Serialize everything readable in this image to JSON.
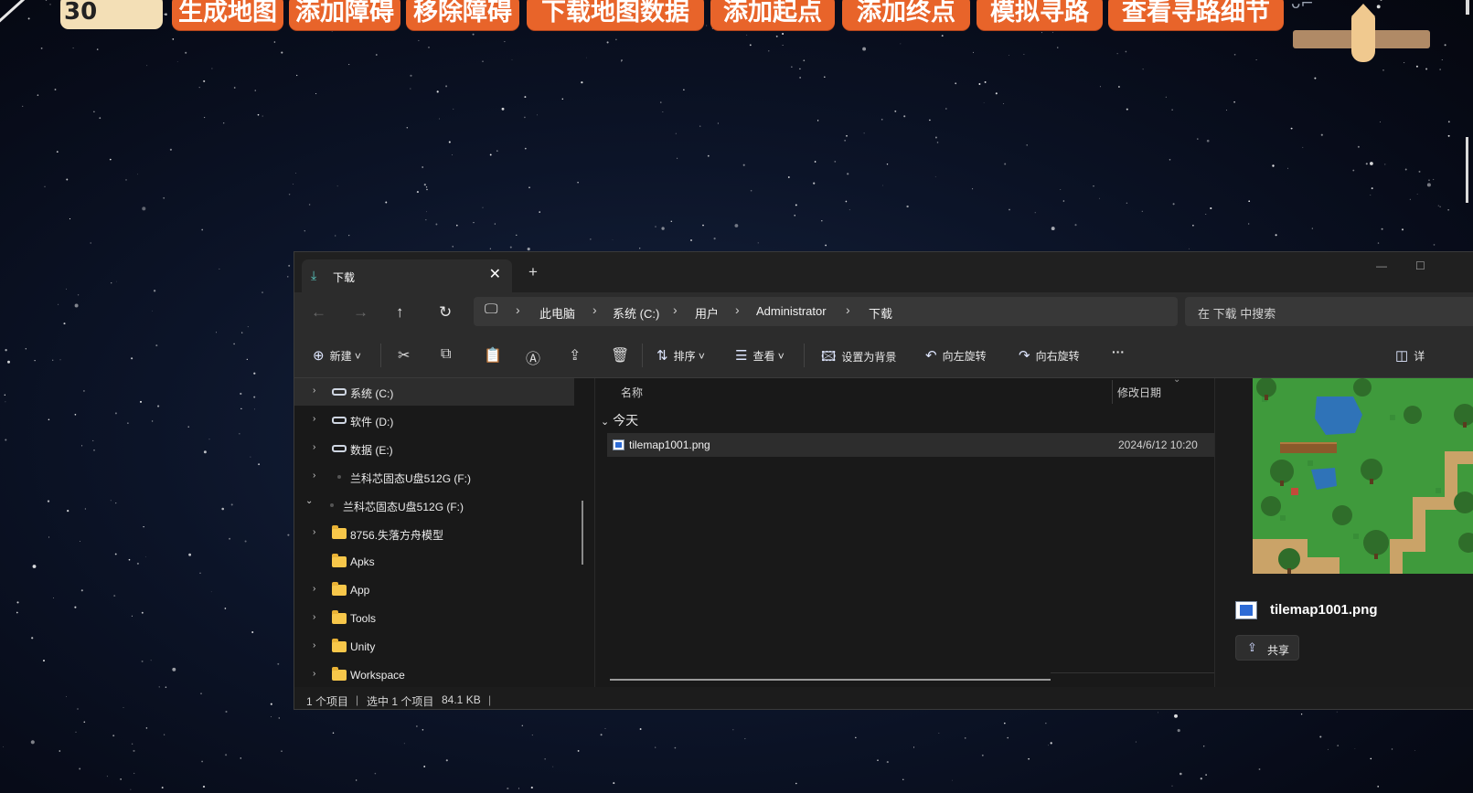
{
  "game": {
    "counter": "30",
    "buttons": [
      "生成地图",
      "添加障碍",
      "移除障碍",
      "下载地图数据",
      "添加起点",
      "添加终点",
      "模拟寻路",
      "查看寻路细节"
    ],
    "button_color": "#e8642a"
  },
  "explorer": {
    "tab": {
      "title": "下载",
      "icon": "download-icon",
      "close": "✕",
      "add": "+"
    },
    "window_controls": {
      "minimize": "—",
      "maximize": "☐"
    },
    "breadcrumb": [
      "此电脑",
      "系统 (C:)",
      "用户",
      "Administrator",
      "下载"
    ],
    "search_placeholder": "在 下载 中搜索",
    "commands": {
      "new": "新建",
      "sort": "排序",
      "view": "查看",
      "set_background": "设置为背景",
      "rotate_left": "向左旋转",
      "rotate_right": "向右旋转",
      "more": "···",
      "details": "详"
    },
    "tree": [
      {
        "label": "系统 (C:)",
        "type": "drive",
        "expandable": true,
        "selected": true
      },
      {
        "label": "软件 (D:)",
        "type": "drive",
        "expandable": true
      },
      {
        "label": "数据 (E:)",
        "type": "drive",
        "expandable": true
      },
      {
        "label": "兰科芯固态U盘512G (F:)",
        "type": "usb",
        "expandable": true
      },
      {
        "label": "兰科芯固态U盘512G (F:)",
        "type": "usb",
        "expanded": true
      },
      {
        "label": "8756.失落方舟模型",
        "type": "folder",
        "expandable": true
      },
      {
        "label": "Apks",
        "type": "folder",
        "expandable": false
      },
      {
        "label": "App",
        "type": "folder",
        "expandable": true
      },
      {
        "label": "Tools",
        "type": "folder",
        "expandable": true
      },
      {
        "label": "Unity",
        "type": "folder",
        "expandable": true
      },
      {
        "label": "Workspace",
        "type": "folder",
        "expandable": true
      }
    ],
    "columns": {
      "name": "名称",
      "modified": "修改日期"
    },
    "group": "今天",
    "files": [
      {
        "name": "tilemap1001.png",
        "modified": "2024/6/12 10:20"
      }
    ],
    "preview": {
      "filename": "tilemap1001.png",
      "share": "共享"
    },
    "status": {
      "count": "1 个项目",
      "selected": "选中 1 个项目",
      "size": "84.1 KB"
    }
  }
}
